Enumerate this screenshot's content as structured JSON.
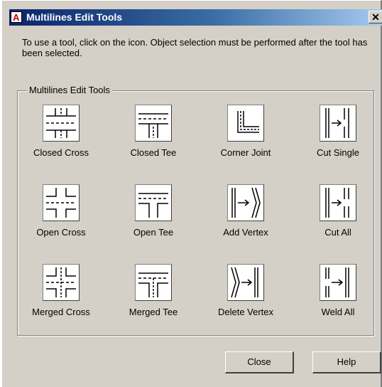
{
  "window": {
    "app_icon": "autocad-icon",
    "app_icon_letter": "A",
    "title": "Multilines Edit Tools",
    "close_glyph": "✕"
  },
  "instructions": "To use a tool, click on the icon.  Object selection must be performed after the tool has been selected.",
  "group": {
    "label": "Multilines Edit Tools",
    "tools": [
      {
        "label": "Closed Cross",
        "icon": "closed-cross-icon"
      },
      {
        "label": "Closed Tee",
        "icon": "closed-tee-icon"
      },
      {
        "label": "Corner Joint",
        "icon": "corner-joint-icon"
      },
      {
        "label": "Cut Single",
        "icon": "cut-single-icon"
      },
      {
        "label": "Open Cross",
        "icon": "open-cross-icon"
      },
      {
        "label": "Open Tee",
        "icon": "open-tee-icon"
      },
      {
        "label": "Add Vertex",
        "icon": "add-vertex-icon"
      },
      {
        "label": "Cut All",
        "icon": "cut-all-icon"
      },
      {
        "label": "Merged Cross",
        "icon": "merged-cross-icon"
      },
      {
        "label": "Merged Tee",
        "icon": "merged-tee-icon"
      },
      {
        "label": "Delete Vertex",
        "icon": "delete-vertex-icon"
      },
      {
        "label": "Weld All",
        "icon": "weld-all-icon"
      }
    ]
  },
  "buttons": {
    "close": "Close",
    "help": "Help"
  },
  "colors": {
    "dialog_face": "#d4d0c8",
    "titlebar_start": "#0a246a",
    "titlebar_end": "#a6caf0"
  }
}
